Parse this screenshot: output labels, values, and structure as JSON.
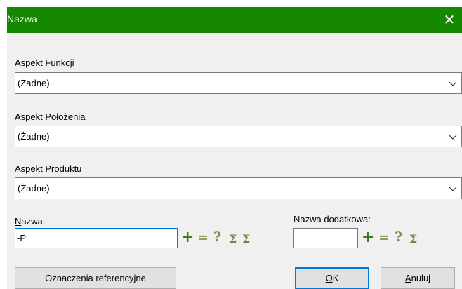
{
  "window": {
    "title": "Nazwa",
    "close_glyph": "✕"
  },
  "fields": {
    "function_aspect": {
      "label_pre": "Aspekt ",
      "label_accel": "F",
      "label_post": "unkcji",
      "value": "(Żadne)"
    },
    "location_aspect": {
      "label_pre": "Aspekt ",
      "label_accel": "P",
      "label_post": "ołożenia",
      "value": "(Żadne)"
    },
    "product_aspect": {
      "label_pre": "Aspekt P",
      "label_accel": "r",
      "label_post": "oduktu",
      "value": "(Żadne)"
    }
  },
  "name": {
    "label_accel": "N",
    "label_post": "azwa:",
    "value": "-P"
  },
  "extra_name": {
    "label": "Nazwa dodatkowa:",
    "value": ""
  },
  "symbols": {
    "plus": "+",
    "equals": "=",
    "question": "?",
    "sigma": "Σ",
    "sigma_check": "Σ"
  },
  "buttons": {
    "references": "Oznaczenia referencyjne",
    "ok_accel": "O",
    "ok_post": "K",
    "cancel_accel": "A",
    "cancel_post": "nuluj"
  }
}
